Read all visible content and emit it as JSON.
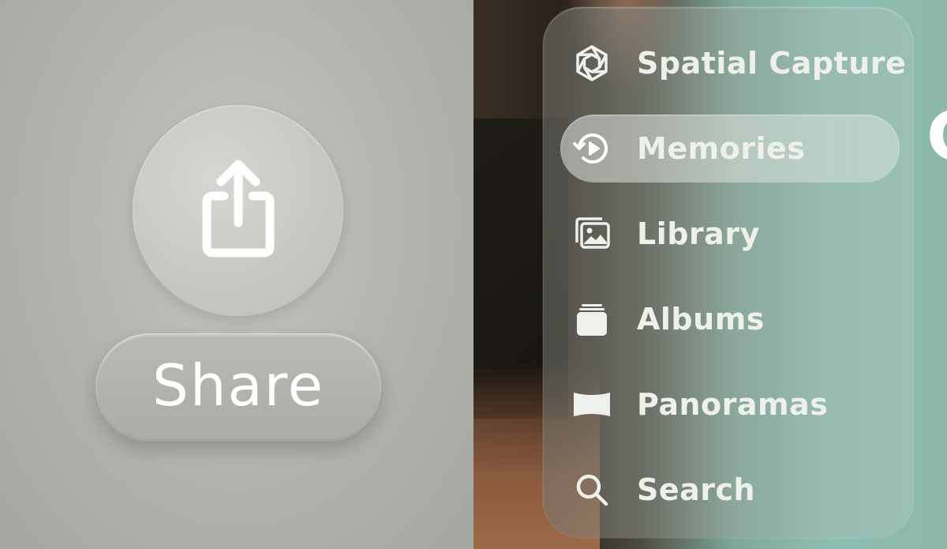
{
  "left": {
    "share_icon": "square-and-arrow-up-icon",
    "share_label": "Share"
  },
  "sidebar": {
    "items": [
      {
        "label": "Spatial Capture",
        "icon": "aperture-icon",
        "selected": false
      },
      {
        "label": "Memories",
        "icon": "memories-play-icon",
        "selected": true
      },
      {
        "label": "Library",
        "icon": "photo-stack-icon",
        "selected": false
      },
      {
        "label": "Albums",
        "icon": "albums-stack-icon",
        "selected": false
      },
      {
        "label": "Panoramas",
        "icon": "panorama-icon",
        "selected": false
      },
      {
        "label": "Search",
        "icon": "magnifying-glass-icon",
        "selected": false
      }
    ]
  },
  "edge_glyph": "G",
  "colors": {
    "icon_white": "#ffffff",
    "label_text": "#eef0ec"
  }
}
